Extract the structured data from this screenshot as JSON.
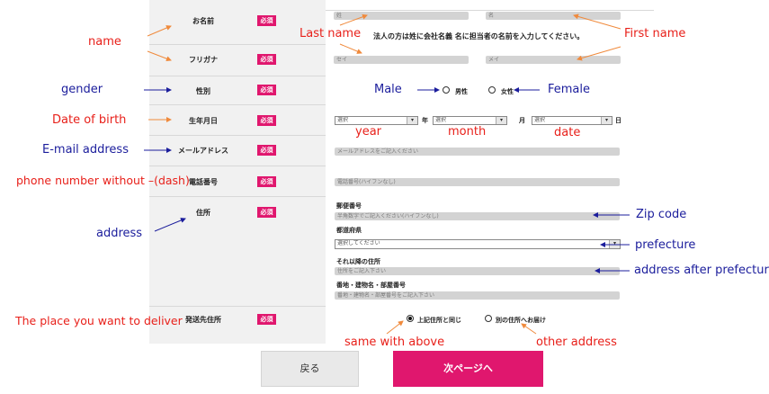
{
  "rows": [
    {
      "key": "name",
      "label": "お名前",
      "required": "必須"
    },
    {
      "key": "kana",
      "label": "フリガナ",
      "required": "必須"
    },
    {
      "key": "gender",
      "label": "性別",
      "required": "必須"
    },
    {
      "key": "dob",
      "label": "生年月日",
      "required": "必須"
    },
    {
      "key": "email",
      "label": "メールアドレス",
      "required": "必須"
    },
    {
      "key": "phone",
      "label": "電話番号",
      "required": "必須"
    },
    {
      "key": "address",
      "label": "住所",
      "required": "必須"
    },
    {
      "key": "delivery",
      "label": "発送先住所",
      "required": "必須"
    }
  ],
  "fields": {
    "last_name_placeholder": "姓",
    "first_name_placeholder": "名",
    "company_note": "法人の方は姓に会社名義 名に担当者の名前を入力してください。",
    "last_kana_placeholder": "セイ",
    "first_kana_placeholder": "メイ",
    "gender_male": "男性",
    "gender_female": "女性",
    "dob_select_placeholder": "選択",
    "dob_year_unit": "年",
    "dob_month_unit": "月",
    "dob_day_unit": "日",
    "email_placeholder": "メールアドレスをご記入ください",
    "phone_placeholder": "電話番号(ハイフンなし)",
    "zip_label": "郵便番号",
    "zip_placeholder": "半角数字でご記入ください(ハイフンなし)",
    "prefecture_label": "都道府県",
    "prefecture_placeholder": "選択してください",
    "address_after_label": "それ以降の住所",
    "address_after_placeholder": "住所をご記入下さい",
    "building_label": "番地・建物名・部屋番号",
    "building_placeholder": "番地・建物名・部屋番号をご記入下さい",
    "delivery_same": "上記住所と同じ",
    "delivery_other": "別の住所へお届け"
  },
  "buttons": {
    "back": "戻る",
    "next": "次ページへ"
  },
  "annotations": {
    "name": "name",
    "gender": "gender",
    "dob": "Date of birth",
    "email": "E-mail address",
    "phone": "phone number without –(dash)",
    "address": "address",
    "delivery": "The place you want to deliver",
    "last_name": "Last name",
    "first_name": "First name",
    "male": "Male",
    "female": "Female",
    "year": "year",
    "month": "month",
    "date": "date",
    "zip": "Zip code",
    "prefecture": "prefecture",
    "address_after": "address after prefecture",
    "same": "same with above",
    "other": "other address"
  },
  "colors": {
    "accent": "#e0176e",
    "annotation_red": "#e8201a",
    "annotation_blue": "#1b1d9c"
  }
}
